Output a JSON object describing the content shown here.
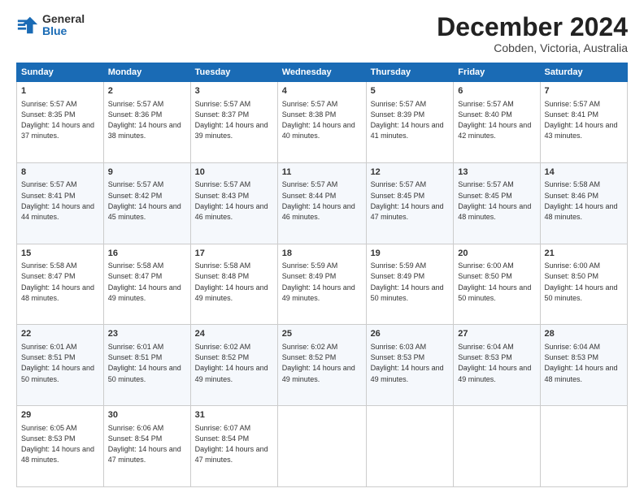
{
  "logo": {
    "general": "General",
    "blue": "Blue"
  },
  "header": {
    "month": "December 2024",
    "location": "Cobden, Victoria, Australia"
  },
  "days_of_week": [
    "Sunday",
    "Monday",
    "Tuesday",
    "Wednesday",
    "Thursday",
    "Friday",
    "Saturday"
  ],
  "weeks": [
    [
      {
        "day": "1",
        "sunrise": "5:57 AM",
        "sunset": "8:35 PM",
        "daylight": "14 hours and 37 minutes."
      },
      {
        "day": "2",
        "sunrise": "5:57 AM",
        "sunset": "8:36 PM",
        "daylight": "14 hours and 38 minutes."
      },
      {
        "day": "3",
        "sunrise": "5:57 AM",
        "sunset": "8:37 PM",
        "daylight": "14 hours and 39 minutes."
      },
      {
        "day": "4",
        "sunrise": "5:57 AM",
        "sunset": "8:38 PM",
        "daylight": "14 hours and 40 minutes."
      },
      {
        "day": "5",
        "sunrise": "5:57 AM",
        "sunset": "8:39 PM",
        "daylight": "14 hours and 41 minutes."
      },
      {
        "day": "6",
        "sunrise": "5:57 AM",
        "sunset": "8:40 PM",
        "daylight": "14 hours and 42 minutes."
      },
      {
        "day": "7",
        "sunrise": "5:57 AM",
        "sunset": "8:41 PM",
        "daylight": "14 hours and 43 minutes."
      }
    ],
    [
      {
        "day": "8",
        "sunrise": "5:57 AM",
        "sunset": "8:41 PM",
        "daylight": "14 hours and 44 minutes."
      },
      {
        "day": "9",
        "sunrise": "5:57 AM",
        "sunset": "8:42 PM",
        "daylight": "14 hours and 45 minutes."
      },
      {
        "day": "10",
        "sunrise": "5:57 AM",
        "sunset": "8:43 PM",
        "daylight": "14 hours and 46 minutes."
      },
      {
        "day": "11",
        "sunrise": "5:57 AM",
        "sunset": "8:44 PM",
        "daylight": "14 hours and 46 minutes."
      },
      {
        "day": "12",
        "sunrise": "5:57 AM",
        "sunset": "8:45 PM",
        "daylight": "14 hours and 47 minutes."
      },
      {
        "day": "13",
        "sunrise": "5:57 AM",
        "sunset": "8:45 PM",
        "daylight": "14 hours and 48 minutes."
      },
      {
        "day": "14",
        "sunrise": "5:58 AM",
        "sunset": "8:46 PM",
        "daylight": "14 hours and 48 minutes."
      }
    ],
    [
      {
        "day": "15",
        "sunrise": "5:58 AM",
        "sunset": "8:47 PM",
        "daylight": "14 hours and 48 minutes."
      },
      {
        "day": "16",
        "sunrise": "5:58 AM",
        "sunset": "8:47 PM",
        "daylight": "14 hours and 49 minutes."
      },
      {
        "day": "17",
        "sunrise": "5:58 AM",
        "sunset": "8:48 PM",
        "daylight": "14 hours and 49 minutes."
      },
      {
        "day": "18",
        "sunrise": "5:59 AM",
        "sunset": "8:49 PM",
        "daylight": "14 hours and 49 minutes."
      },
      {
        "day": "19",
        "sunrise": "5:59 AM",
        "sunset": "8:49 PM",
        "daylight": "14 hours and 50 minutes."
      },
      {
        "day": "20",
        "sunrise": "6:00 AM",
        "sunset": "8:50 PM",
        "daylight": "14 hours and 50 minutes."
      },
      {
        "day": "21",
        "sunrise": "6:00 AM",
        "sunset": "8:50 PM",
        "daylight": "14 hours and 50 minutes."
      }
    ],
    [
      {
        "day": "22",
        "sunrise": "6:01 AM",
        "sunset": "8:51 PM",
        "daylight": "14 hours and 50 minutes."
      },
      {
        "day": "23",
        "sunrise": "6:01 AM",
        "sunset": "8:51 PM",
        "daylight": "14 hours and 50 minutes."
      },
      {
        "day": "24",
        "sunrise": "6:02 AM",
        "sunset": "8:52 PM",
        "daylight": "14 hours and 49 minutes."
      },
      {
        "day": "25",
        "sunrise": "6:02 AM",
        "sunset": "8:52 PM",
        "daylight": "14 hours and 49 minutes."
      },
      {
        "day": "26",
        "sunrise": "6:03 AM",
        "sunset": "8:53 PM",
        "daylight": "14 hours and 49 minutes."
      },
      {
        "day": "27",
        "sunrise": "6:04 AM",
        "sunset": "8:53 PM",
        "daylight": "14 hours and 49 minutes."
      },
      {
        "day": "28",
        "sunrise": "6:04 AM",
        "sunset": "8:53 PM",
        "daylight": "14 hours and 48 minutes."
      }
    ],
    [
      {
        "day": "29",
        "sunrise": "6:05 AM",
        "sunset": "8:53 PM",
        "daylight": "14 hours and 48 minutes."
      },
      {
        "day": "30",
        "sunrise": "6:06 AM",
        "sunset": "8:54 PM",
        "daylight": "14 hours and 47 minutes."
      },
      {
        "day": "31",
        "sunrise": "6:07 AM",
        "sunset": "8:54 PM",
        "daylight": "14 hours and 47 minutes."
      },
      null,
      null,
      null,
      null
    ]
  ]
}
